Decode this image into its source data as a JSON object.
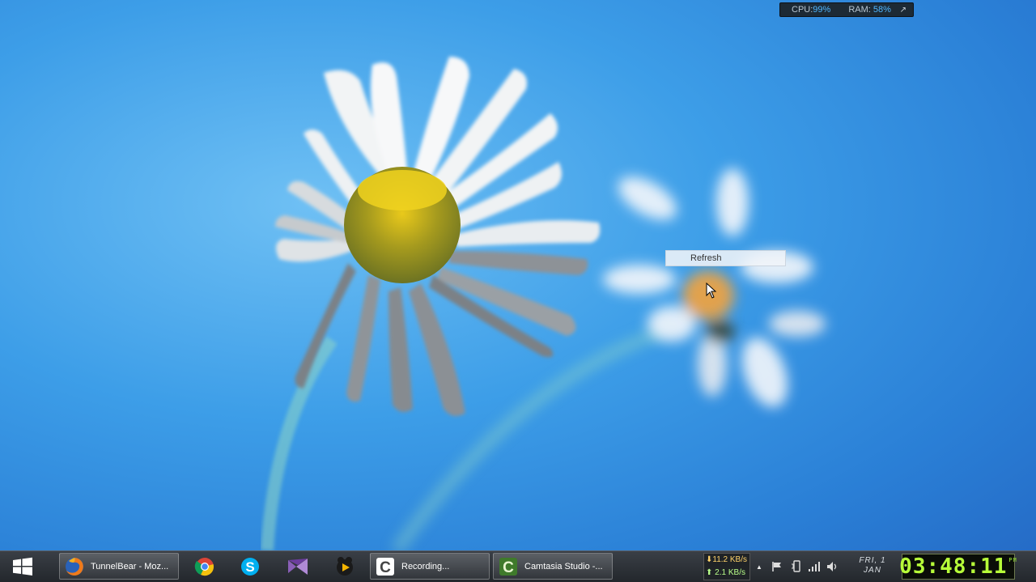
{
  "resource_meter": {
    "cpu_label": "CPU:",
    "cpu_value": "99%",
    "ram_label": "RAM:",
    "ram_value": "58%",
    "pin_icon": "arrow-up-right-icon"
  },
  "context_menu": {
    "items": [
      {
        "label": "Refresh"
      }
    ]
  },
  "taskbar": {
    "start_icon": "windows-logo-icon",
    "buttons": [
      {
        "label": "TunnelBear - Moz...",
        "icon": "firefox-icon"
      },
      {
        "label": "Recording...",
        "icon": "camtasia-recorder-icon"
      },
      {
        "label": "Camtasia Studio -...",
        "icon": "camtasia-studio-icon"
      }
    ],
    "pinned": [
      {
        "name": "chrome-icon"
      },
      {
        "name": "skype-icon"
      },
      {
        "name": "visual-studio-icon"
      },
      {
        "name": "media-player-icon"
      }
    ],
    "net_speed": {
      "download": "11.2 KB/s",
      "upload": "2.1 KB/s"
    },
    "tray": {
      "overflow": "▲"
    },
    "date": {
      "day": "FRI, 1",
      "month": "JAN"
    },
    "clock": {
      "time": "03:48:11",
      "period": "PM"
    }
  },
  "colors": {
    "wallpaper": "#3d9ee8",
    "taskbar": "#2d3237",
    "clock_digits": "#b7ff39"
  }
}
